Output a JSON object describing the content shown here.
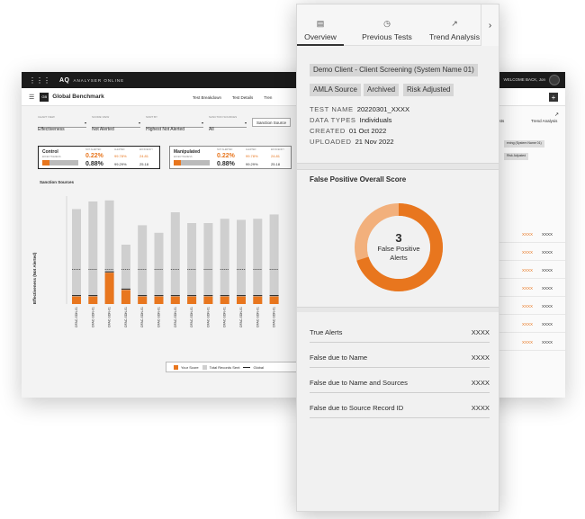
{
  "dashboard": {
    "brand": "AQ",
    "brand_sub": "ANALYSER ONLINE",
    "welcome": "WELCOME BACK, Jon",
    "title_badge": "GB",
    "title": "Global Benchmark",
    "tabs": [
      "Test Breakdown",
      "Test Details",
      "Tren"
    ],
    "filters": [
      {
        "label": "CHART VIEW",
        "value": "Effectiveness"
      },
      {
        "label": "SCORE VIEW",
        "value": "Not Alerted"
      },
      {
        "label": "SORT BY",
        "value": "Highest Not Alerted"
      },
      {
        "label": "SANCTION SOURCES",
        "value": "All"
      }
    ],
    "sanction_button": "Sanction Source",
    "cards": [
      {
        "name": "Control",
        "sub": "EFFECTIVENESS",
        "col1": "NOT ALERTED",
        "col2": "ALERTED",
        "col3": "EFFICIENCY",
        "v1": "0.22%",
        "v2": "0.88%",
        "v3": "99.78%",
        "v4": "99.29%",
        "v5": "24.81",
        "v6": "25.18"
      },
      {
        "name": "Manipulated",
        "sub": "EFFECTIVENESS",
        "col1": "NOT ALERTED",
        "col2": "ALERTED",
        "col3": "EFFICIENCY",
        "v1": "0.22%",
        "v2": "0.88%",
        "v3": "99.78%",
        "v4": "99.29%",
        "v5": "24.81",
        "v6": "25.18"
      }
    ],
    "chart_title": "Sanction Sources",
    "ylabel": "Effectiveness (Not Alerted)",
    "legend": {
      "your_score": "Your Score",
      "total_records": "Total Records Sent",
      "global": "Global"
    },
    "right": {
      "tabs": [
        "ests",
        "Trend Analysis"
      ],
      "chips": [
        "ening (System Name 01)",
        "Risk Adjusted"
      ],
      "rows": [
        {
          "orange": "XXXX",
          "black": "XXXX"
        },
        {
          "orange": "XXXX",
          "black": "XXXX"
        },
        {
          "orange": "XXXX",
          "black": "XXXX"
        },
        {
          "orange": "XXXX",
          "black": "XXXX"
        },
        {
          "orange": "XXXX",
          "black": "XXXX"
        },
        {
          "orange": "XXXX",
          "black": "XXXX"
        },
        {
          "orange": "XXXX",
          "black": "XXXX"
        }
      ]
    }
  },
  "chart_data": {
    "type": "bar",
    "categories": [
      "OFAC-SDN-01",
      "OFAC-SDN-01",
      "OFAC-SDN-01",
      "OFAC-SDN-01",
      "OFAC-SDN-01",
      "OFAC-SDN-01",
      "OFAC-SDN-01",
      "OFAC-SDN-01",
      "OFAC-SDN-01",
      "OFAC-SDN-01",
      "OFAC-SDN-01",
      "OFAC-SDN-01",
      "OFAC-SDN-01"
    ],
    "series": [
      {
        "name": "Total Records Sent",
        "values": [
          0.88,
          0.95,
          0.96,
          0.55,
          0.73,
          0.66,
          0.85,
          0.75,
          0.75,
          0.79,
          0.78,
          0.79,
          0.83
        ]
      },
      {
        "name": "Your Score",
        "values": [
          0.07,
          0.07,
          0.29,
          0.13,
          0.07,
          0.07,
          0.07,
          0.07,
          0.07,
          0.07,
          0.07,
          0.07,
          0.07
        ]
      },
      {
        "name": "Global",
        "values": [
          0.32,
          0.32,
          0.32,
          0.32,
          0.32,
          0.32,
          0.32,
          0.32,
          0.32,
          0.32,
          0.32,
          0.32,
          0.32
        ]
      }
    ],
    "ylim": [
      0,
      1
    ],
    "colors": {
      "total": "#cfcfcf",
      "score": "#e8761e",
      "global": "#222222"
    }
  },
  "panel": {
    "tabs": [
      {
        "label": "Overview",
        "icon": "document-icon"
      },
      {
        "label": "Previous Tests",
        "icon": "history-icon"
      },
      {
        "label": "Trend Analysis",
        "icon": "trend-icon"
      }
    ],
    "next_icon": "chevron-right-icon",
    "client_chip": "Demo Client - Client Screening (System Name 01)",
    "tags": [
      "AMLA Source",
      "Archived",
      "Risk Adjusted"
    ],
    "meta": [
      {
        "key": "TEST NAME",
        "value": "20220301_XXXX"
      },
      {
        "key": "DATA TYPES",
        "value": "Individuals"
      },
      {
        "key": "CREATED",
        "value": "01 Oct 2022"
      },
      {
        "key": "UPLOADED",
        "value": "21 Nov 2022"
      }
    ],
    "score_title": "False Positive Overall Score",
    "score_value": "3",
    "score_label_1": "False Positive",
    "score_label_2": "Alerts",
    "donut_fraction": 0.7,
    "rows": [
      {
        "label": "True Alerts",
        "value": "XXXX"
      },
      {
        "label": "False due to Name",
        "value": "XXXX"
      },
      {
        "label": "False due to Name and Sources",
        "value": "XXXX"
      },
      {
        "label": "False due to Source Record ID",
        "value": "XXXX"
      }
    ],
    "accent": "#e8761e"
  }
}
